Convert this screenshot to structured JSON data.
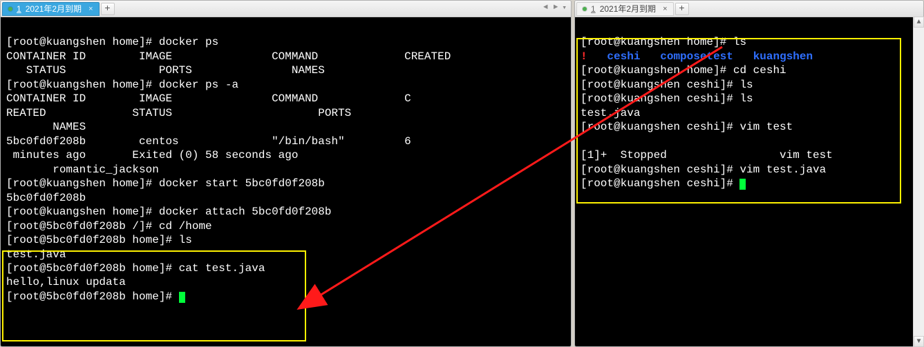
{
  "left": {
    "tab": {
      "num": "1",
      "label": "2021年2月到期",
      "close": "×"
    },
    "add_label": "+",
    "nav": {
      "prev": "◄",
      "next": "►",
      "menu": "▾"
    },
    "lines": {
      "l01a": "[root@kuangshen home]# ",
      "l01b": "docker ps",
      "l02": "CONTAINER ID        IMAGE               COMMAND             CREATED  ",
      "l03": "   STATUS              PORTS               NAMES",
      "l04a": "[root@kuangshen home]# ",
      "l04b": "docker ps -a",
      "l05": "CONTAINER ID        IMAGE               COMMAND             C",
      "l06": "REATED             STATUS                      PORTS        ",
      "l07": "       NAMES",
      "l08": "5bc0fd0f208b        centos              \"/bin/bash\"         6",
      "l09": " minutes ago       Exited (0) 58 seconds ago                ",
      "l10": "       romantic_jackson",
      "l11a": "[root@kuangshen home]# ",
      "l11b": "docker start 5bc0fd0f208b",
      "l12": "5bc0fd0f208b",
      "l13a": "[root@kuangshen home]# ",
      "l13b": "docker attach 5bc0fd0f208b",
      "l14a": "[root@5bc0fd0f208b /]# ",
      "l14b": "cd /home",
      "l15a": "[root@5bc0fd0f208b home]# ",
      "l15b": "ls",
      "l16": "test.java",
      "l17a": "[root@5bc0fd0f208b home]# ",
      "l17b": "cat test.java",
      "l18": "hello,linux updata",
      "l19a": "[root@5bc0fd0f208b home]# "
    }
  },
  "right": {
    "tab": {
      "num": "1",
      "label": "2021年2月到期",
      "close": "×"
    },
    "add_label": "+",
    "scroll": {
      "up": "▲",
      "down": "▼"
    },
    "lines": {
      "l01a": "[root@kuangshen home]# ",
      "l01b": "ls",
      "ls_items": {
        "a": "!",
        "b": "ceshi",
        "c": "composetest",
        "d": "kuangshen"
      },
      "l03a": "[root@kuangshen home]# ",
      "l03b": "cd ceshi",
      "l04a": "[root@kuangshen ceshi]# ",
      "l04b": "ls",
      "l05a": "[root@kuangshen ceshi]# ",
      "l05b": "ls",
      "l06": "test.java",
      "l07a": "[root@kuangshen ceshi]# ",
      "l07b": "vim test",
      "l08": "",
      "l09": "[1]+  Stopped                 vim test",
      "l10a": "[root@kuangshen ceshi]# ",
      "l10b": "vim test.java",
      "l11a": "[root@kuangshen ceshi]# "
    }
  }
}
